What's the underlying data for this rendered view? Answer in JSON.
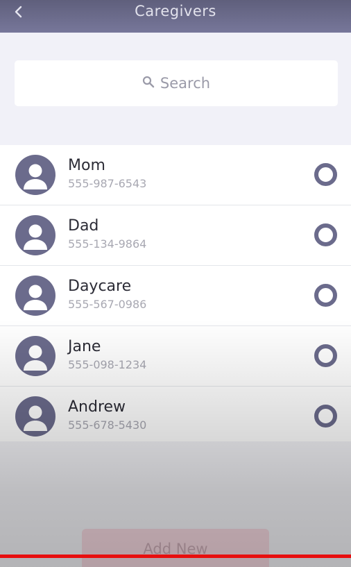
{
  "header": {
    "title": "Caregivers",
    "back_icon": "chevron-left-icon"
  },
  "search": {
    "placeholder": "Search",
    "icon": "search-icon"
  },
  "caregivers": [
    {
      "name": "Mom",
      "phone": "555-987-6543"
    },
    {
      "name": "Dad",
      "phone": "555-134-9864"
    },
    {
      "name": "Daycare",
      "phone": "555-567-0986"
    },
    {
      "name": "Jane",
      "phone": "555-098-1234"
    },
    {
      "name": "Andrew",
      "phone": "555-678-5430"
    }
  ],
  "actions": {
    "add_new_label": "Add New"
  },
  "colors": {
    "header": "#6a6a8a",
    "accent": "#6b6b8c",
    "add_button": "#f3d6de",
    "highlight_line": "#e80e0e"
  }
}
